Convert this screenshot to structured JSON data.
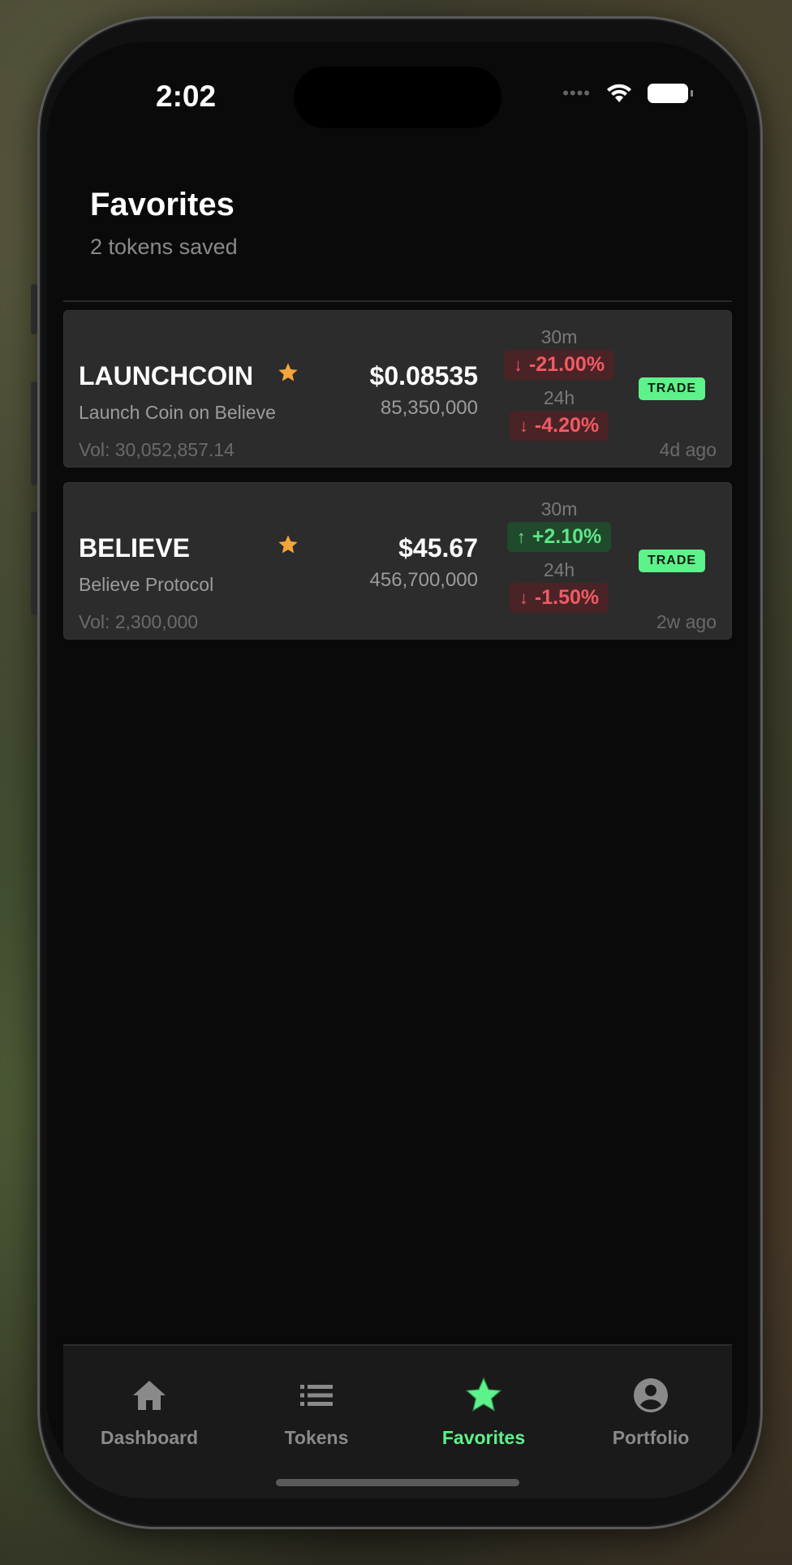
{
  "status_bar": {
    "time": "2:02"
  },
  "header": {
    "title": "Favorites",
    "subtitle": "2 tokens saved"
  },
  "favorites": [
    {
      "symbol": "LAUNCHCOIN",
      "name": "Launch Coin on Believe",
      "price": "$0.08535",
      "supply": "85,350,000",
      "volume": "Vol: 30,052,857.14",
      "change_30m_label": "30m",
      "change_30m": "-21.00%",
      "change_30m_dir": "down",
      "change_24h_label": "24h",
      "change_24h": "-4.20%",
      "change_24h_dir": "down",
      "trade_label": "TRADE",
      "age": "4d ago"
    },
    {
      "symbol": "BELIEVE",
      "name": "Believe Protocol",
      "price": "$45.67",
      "supply": "456,700,000",
      "volume": "Vol: 2,300,000",
      "change_30m_label": "30m",
      "change_30m": "+2.10%",
      "change_30m_dir": "up",
      "change_24h_label": "24h",
      "change_24h": "-1.50%",
      "change_24h_dir": "down",
      "trade_label": "TRADE",
      "age": "2w ago"
    }
  ],
  "tab_bar": {
    "tabs": [
      {
        "label": "Dashboard",
        "icon": "home-icon"
      },
      {
        "label": "Tokens",
        "icon": "list-icon"
      },
      {
        "label": "Favorites",
        "icon": "star-icon",
        "active": true
      },
      {
        "label": "Portfolio",
        "icon": "account-icon"
      }
    ]
  },
  "colors": {
    "accent": "#5ef28a",
    "negative": "#f15a63",
    "favorite_star": "#f5a53a",
    "background": "#0a0a0a",
    "card": "#2c2c2c"
  }
}
